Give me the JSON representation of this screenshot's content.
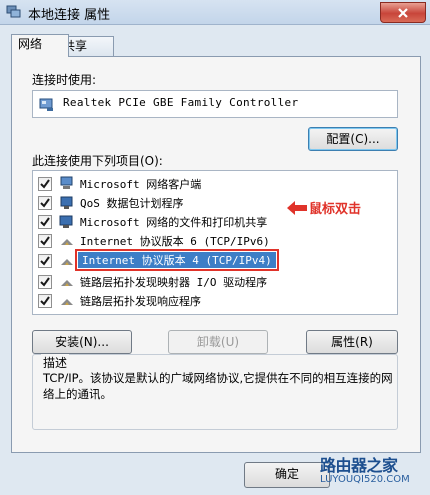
{
  "window": {
    "title": "本地连接 属性"
  },
  "tabs": [
    {
      "label": "网络",
      "active": true
    },
    {
      "label": "共享",
      "active": false
    }
  ],
  "connect_using": {
    "label": "连接时使用:",
    "adapter": "Realtek PCIe GBE Family Controller",
    "configure_button": "配置(C)..."
  },
  "items_section": {
    "label": "此连接使用下列项目(O):",
    "items": [
      {
        "text": "Microsoft 网络客户端",
        "checked": true,
        "icon": "network-client-icon"
      },
      {
        "text": "QoS 数据包计划程序",
        "checked": true,
        "icon": "qos-scheduler-icon"
      },
      {
        "text": "Microsoft 网络的文件和打印机共享",
        "checked": true,
        "icon": "file-print-sharing-icon"
      },
      {
        "text": "Internet 协议版本 6 (TCP/IPv6)",
        "checked": true,
        "icon": "protocol-icon"
      },
      {
        "text": "Internet 协议版本 4 (TCP/IPv4)",
        "checked": true,
        "icon": "protocol-icon",
        "selected": true
      },
      {
        "text": "链路层拓扑发现映射器 I/O 驱动程序",
        "checked": true,
        "icon": "protocol-icon"
      },
      {
        "text": "链路层拓扑发现响应程序",
        "checked": true,
        "icon": "protocol-icon"
      }
    ]
  },
  "annotation": {
    "text": "鼠标双击",
    "color": "#e0332a"
  },
  "buttons": {
    "install": "安装(N)...",
    "uninstall": "卸载(U)",
    "properties": "属性(R)",
    "ok": "确定"
  },
  "description": {
    "title": "描述",
    "text": "TCP/IP。该协议是默认的广域网络协议,它提供在不同的相互连接的网络上的通讯。"
  },
  "watermark": {
    "title": "路由器之家",
    "url": "LUYOUQI520.COM"
  },
  "colors": {
    "selection": "#3d7ec6",
    "accent_red": "#e0332a",
    "title_bar": "#c3d5ea"
  }
}
